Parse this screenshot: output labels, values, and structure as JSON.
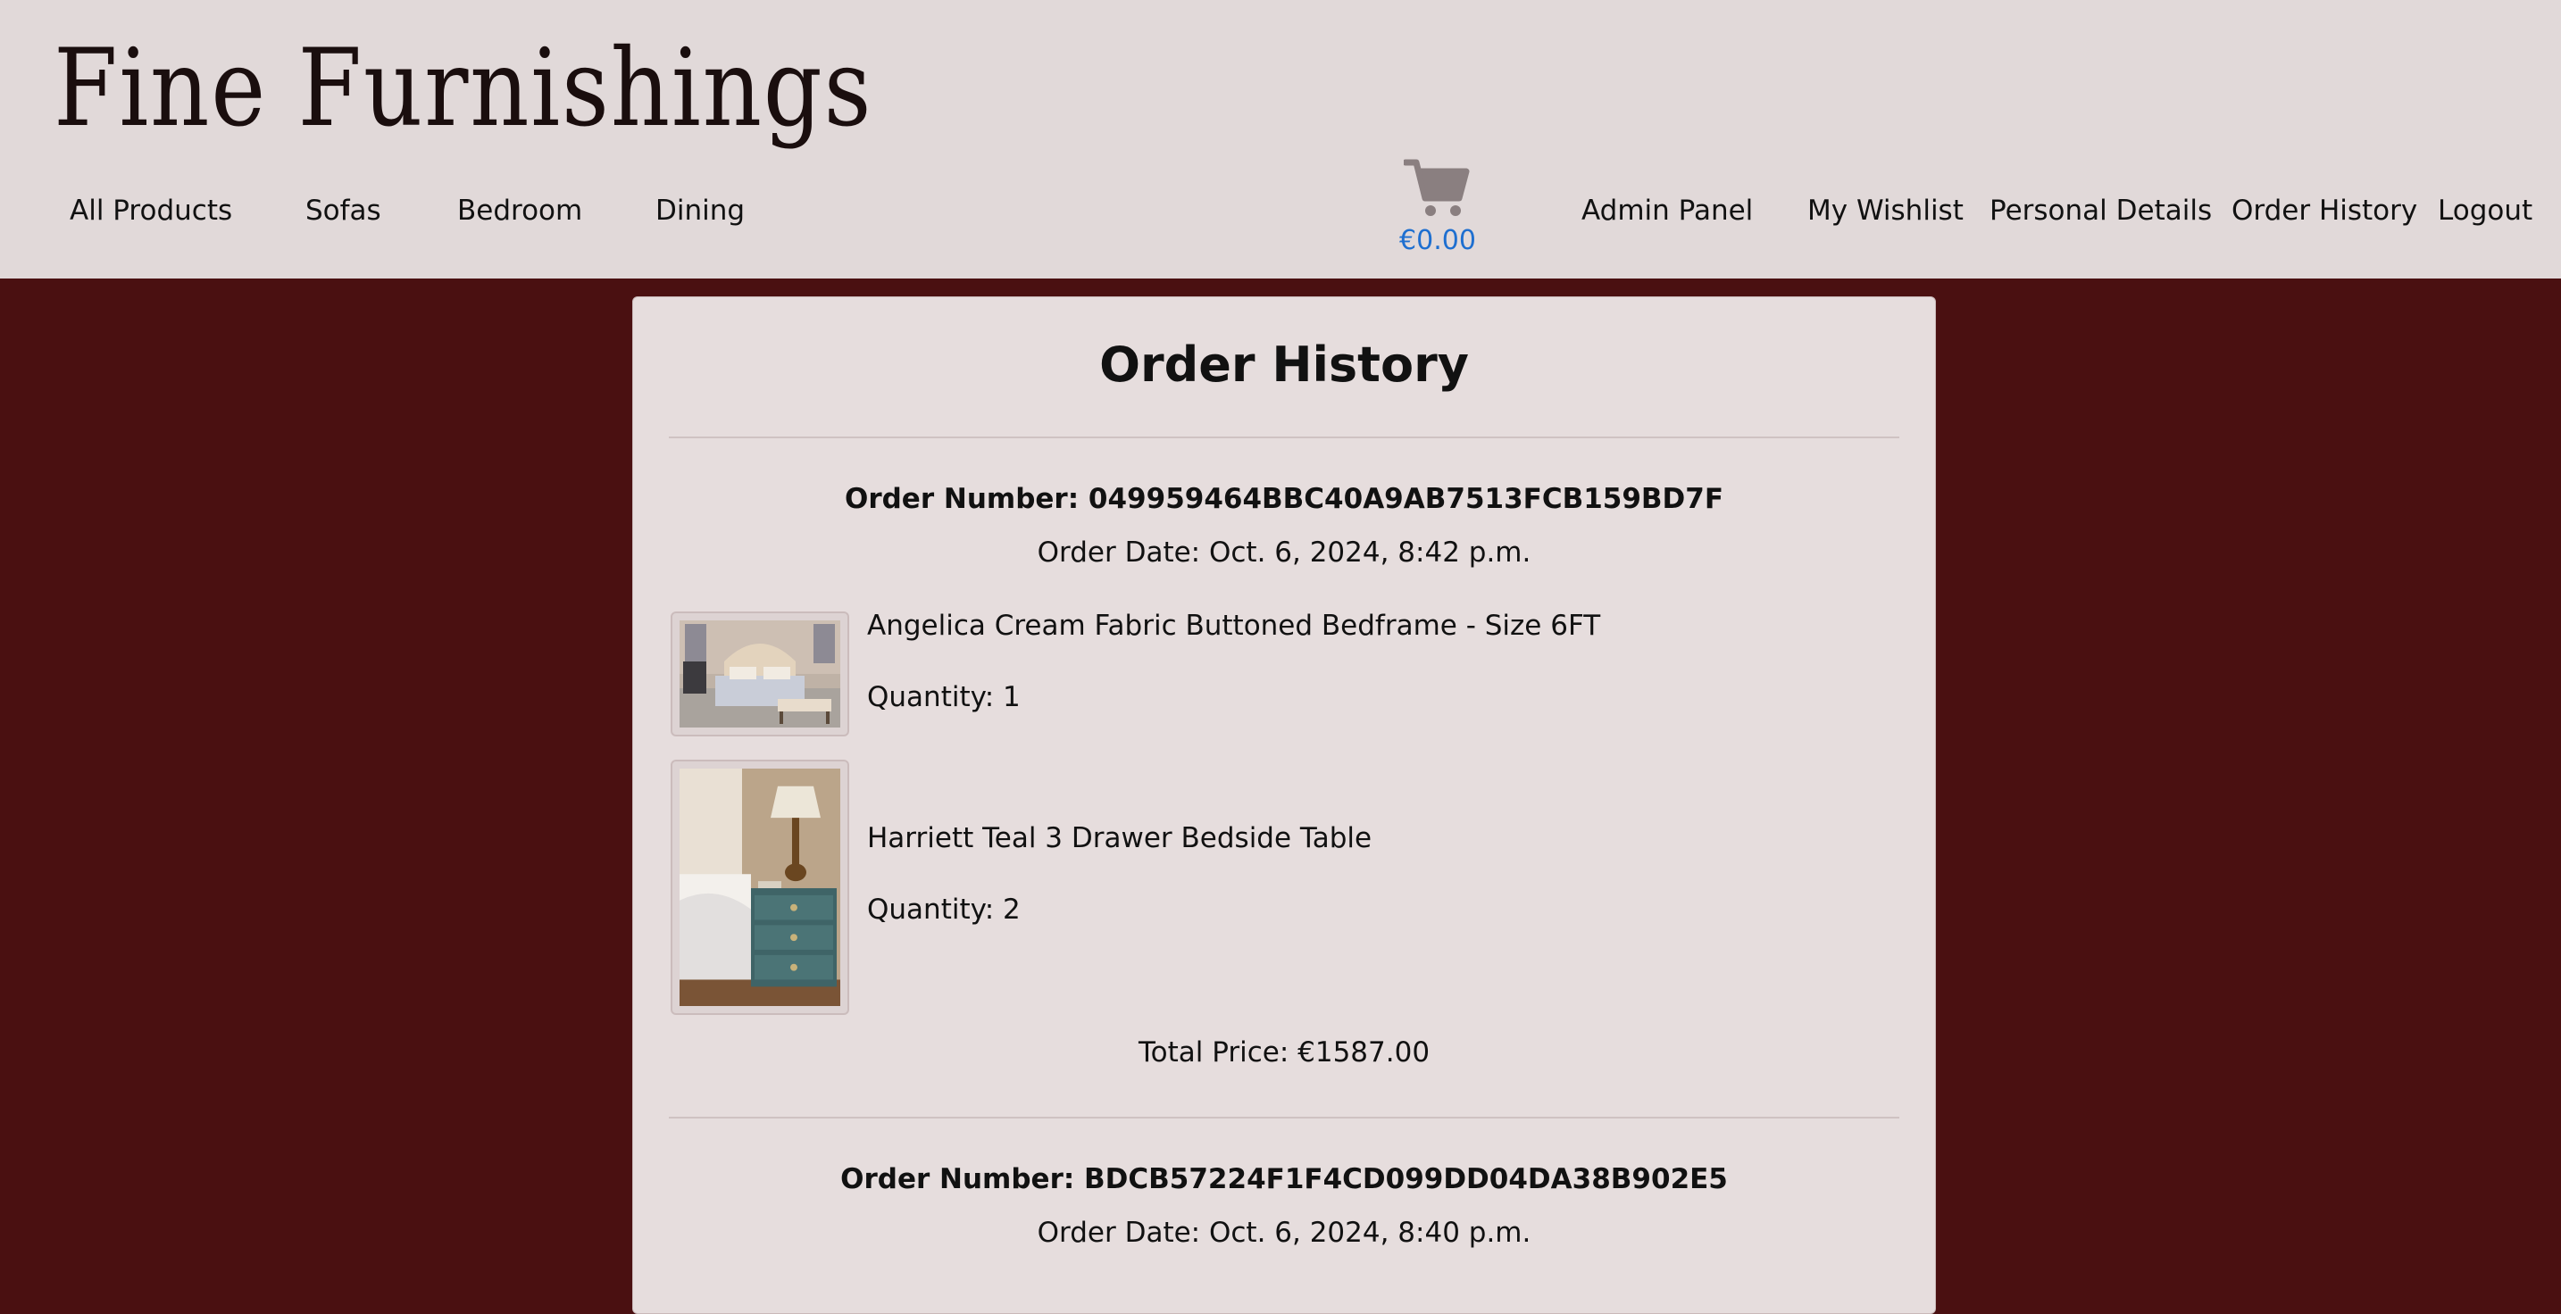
{
  "brand": "Fine Furnishings",
  "nav": {
    "left": [
      "All Products",
      "Sofas",
      "Bedroom",
      "Dining"
    ],
    "right": [
      "Admin Panel",
      "My Wishlist",
      "Personal Details",
      "Order History",
      "Logout"
    ]
  },
  "cart": {
    "icon": "cart-icon",
    "total": "€0.00"
  },
  "page": {
    "title": "Order History"
  },
  "orders": [
    {
      "number": "Order Number: 049959464BBC40A9AB7513FCB159BD7F",
      "date": "Order Date: Oct. 6, 2024, 8:42 p.m.",
      "items": [
        {
          "name": "Angelica Cream Fabric Buttoned Bedframe - Size 6FT",
          "quantity": "Quantity: 1",
          "image": "bedframe-photo"
        },
        {
          "name": "Harriett Teal 3 Drawer Bedside Table",
          "quantity": "Quantity: 2",
          "image": "bedside-table-photo"
        }
      ],
      "total": "Total Price: €1587.00"
    },
    {
      "number": "Order Number: BDCB57224F1F4CD099DD04DA38B902E5",
      "date": "Order Date: Oct. 6, 2024, 8:40 p.m."
    }
  ],
  "colors": {
    "header_bg": "#e1d9d9",
    "page_bg": "#4a1011",
    "card_bg": "#e6dddd",
    "cart_total": "#1e6fd0",
    "cart_icon": "#8a7f80"
  }
}
